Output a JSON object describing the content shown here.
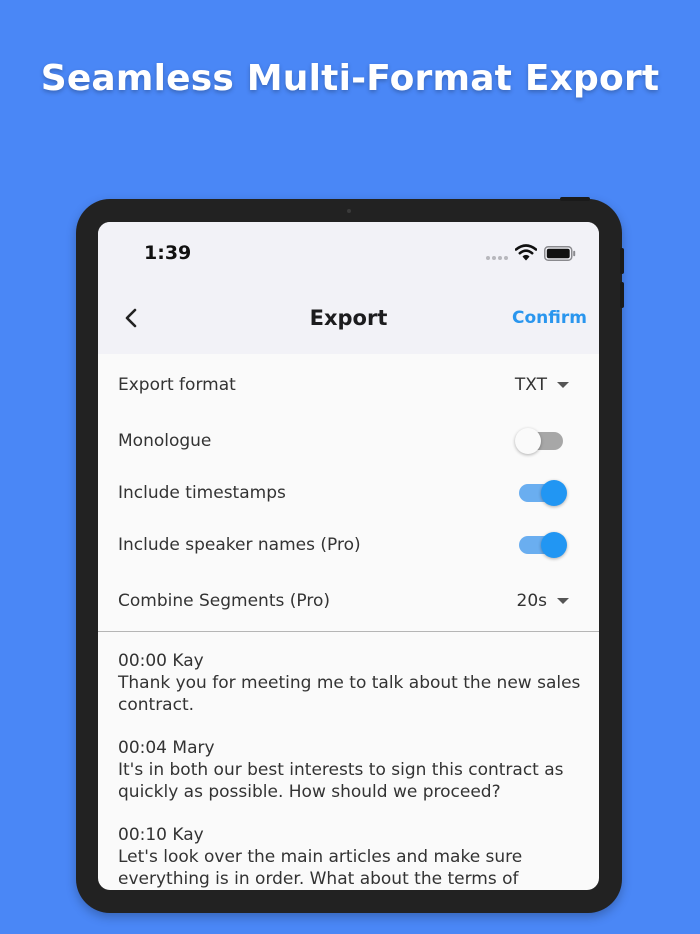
{
  "headline": "Seamless Multi-Format Export",
  "status_bar": {
    "time": "1:39"
  },
  "nav": {
    "back_icon": "chevron-left-icon",
    "title": "Export",
    "confirm_label": "Confirm"
  },
  "settings": {
    "export_format": {
      "label": "Export format",
      "value": "TXT"
    },
    "monologue": {
      "label": "Monologue",
      "enabled": false
    },
    "timestamps": {
      "label": "Include timestamps",
      "enabled": true
    },
    "speaker_names": {
      "label": "Include speaker names (Pro)",
      "enabled": true
    },
    "combine_segments": {
      "label": "Combine Segments (Pro)",
      "value": "20s"
    }
  },
  "transcript": [
    {
      "time": "00:00",
      "speaker": "Kay",
      "text": "Thank you for meeting me to talk about the new sales contract."
    },
    {
      "time": "00:04",
      "speaker": "Mary",
      "text": "It's in both our best interests to sign this contract as quickly as possible. How should we proceed?"
    },
    {
      "time": "00:10",
      "speaker": "Kay",
      "text": "Let's look over the main articles and make sure everything is in order. What about the terms of"
    }
  ],
  "colors": {
    "background": "#4a87f6",
    "accent": "#2a96ee",
    "toggle_on": "#2196f3"
  }
}
